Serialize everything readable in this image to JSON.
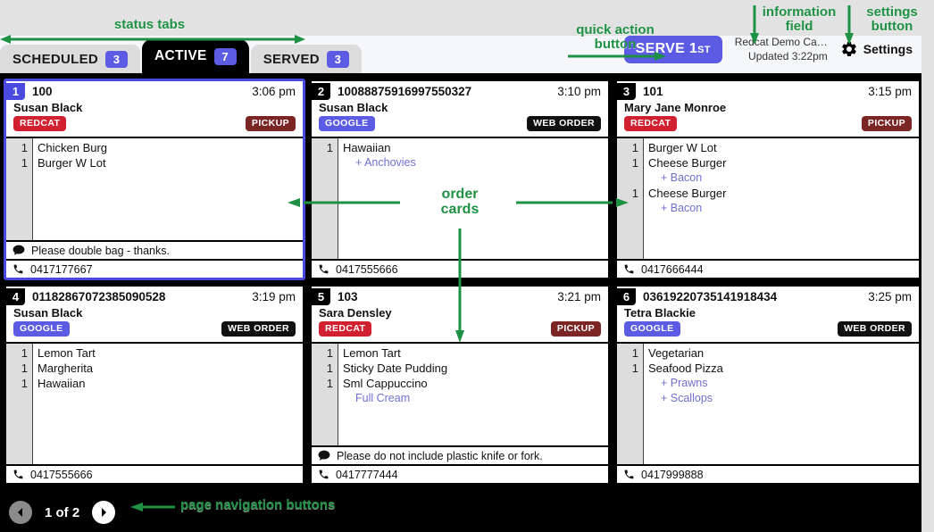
{
  "header": {
    "tabs": [
      {
        "label": "SCHEDULED",
        "count": "3",
        "active": false
      },
      {
        "label": "ACTIVE",
        "count": "7",
        "active": true
      },
      {
        "label": "SERVED",
        "count": "3",
        "active": false
      }
    ],
    "serve_button": {
      "label": "SERVE 1",
      "suffix": "ST"
    },
    "info_field": {
      "line1": "Redcat Demo Ca…",
      "line2": "Updated 3:22pm"
    },
    "settings": {
      "label": "Settings",
      "icon": "gear-icon"
    }
  },
  "cards": [
    {
      "seq": "1",
      "order_no": "100",
      "time": "3:06 pm",
      "customer": "Susan Black",
      "source_badge": "REDCAT",
      "source_type": "redcat",
      "service_badge": "PICKUP",
      "service_type": "pickup",
      "selected": true,
      "items": [
        {
          "qty": "1",
          "name": "Chicken Burg",
          "mods": []
        },
        {
          "qty": "1",
          "name": "Burger W Lot",
          "mods": []
        }
      ],
      "note": "Please double bag - thanks.",
      "phone": "0417177667"
    },
    {
      "seq": "2",
      "order_no": "10088875916997550327",
      "time": "3:10 pm",
      "customer": "Susan Black",
      "source_badge": "GOOGLE",
      "source_type": "google",
      "service_badge": "WEB ORDER",
      "service_type": "weborder",
      "selected": false,
      "items": [
        {
          "qty": "1",
          "name": "Hawaiian",
          "mods": [
            "+ Anchovies"
          ]
        }
      ],
      "note": "",
      "phone": "0417555666"
    },
    {
      "seq": "3",
      "order_no": "101",
      "time": "3:15 pm",
      "customer": "Mary Jane Monroe",
      "source_badge": "REDCAT",
      "source_type": "redcat",
      "service_badge": "PICKUP",
      "service_type": "pickup",
      "selected": false,
      "items": [
        {
          "qty": "1",
          "name": "Burger W Lot",
          "mods": []
        },
        {
          "qty": "1",
          "name": "Cheese Burger",
          "mods": [
            "+ Bacon"
          ]
        },
        {
          "qty": "1",
          "name": "Cheese Burger",
          "mods": [
            "+ Bacon"
          ]
        }
      ],
      "note": "",
      "phone": "0417666444"
    },
    {
      "seq": "4",
      "order_no": "01182867072385090528",
      "time": "3:19 pm",
      "customer": "Susan Black",
      "source_badge": "GOOGLE",
      "source_type": "google",
      "service_badge": "WEB ORDER",
      "service_type": "weborder",
      "selected": false,
      "items": [
        {
          "qty": "1",
          "name": "Lemon Tart",
          "mods": []
        },
        {
          "qty": "1",
          "name": "Margherita",
          "mods": []
        },
        {
          "qty": "1",
          "name": "Hawaiian",
          "mods": []
        }
      ],
      "note": "",
      "phone": "0417555666"
    },
    {
      "seq": "5",
      "order_no": "103",
      "time": "3:21 pm",
      "customer": "Sara Densley",
      "source_badge": "REDCAT",
      "source_type": "redcat",
      "service_badge": "PICKUP",
      "service_type": "pickup",
      "selected": false,
      "items": [
        {
          "qty": "1",
          "name": "Lemon Tart",
          "mods": []
        },
        {
          "qty": "1",
          "name": "Sticky Date Pudding",
          "mods": []
        },
        {
          "qty": "1",
          "name": "Sml Cappuccino",
          "mods": [
            "Full Cream"
          ]
        }
      ],
      "note": "Please do not include plastic knife or fork.",
      "phone": "0417777444"
    },
    {
      "seq": "6",
      "order_no": "03619220735141918434",
      "time": "3:25 pm",
      "customer": "Tetra Blackie",
      "source_badge": "GOOGLE",
      "source_type": "google",
      "service_badge": "WEB ORDER",
      "service_type": "weborder",
      "selected": false,
      "items": [
        {
          "qty": "1",
          "name": "Vegetarian",
          "mods": []
        },
        {
          "qty": "1",
          "name": "Seafood Pizza",
          "mods": [
            "+ Prawns",
            "+ Scallops"
          ]
        }
      ],
      "note": "",
      "phone": "0417999888"
    }
  ],
  "pager": {
    "prev_icon": "arrow-left-icon",
    "next_icon": "arrow-right-icon",
    "page_text": "1 of 2"
  },
  "annotations": {
    "status_tabs": "status tabs",
    "quick_action": "quick action\nbutton",
    "information_field": "information\nfield",
    "settings_button": "settings\nbutton",
    "order_cards": "order\ncards",
    "page_navigation": "page navigation buttons"
  },
  "colors": {
    "accent": "#5b5be4",
    "annotation_green": "#1f9144",
    "redcat_red": "#d12030",
    "pickup_maroon": "#7b2525",
    "modifier_purple": "#6f6fd0"
  }
}
